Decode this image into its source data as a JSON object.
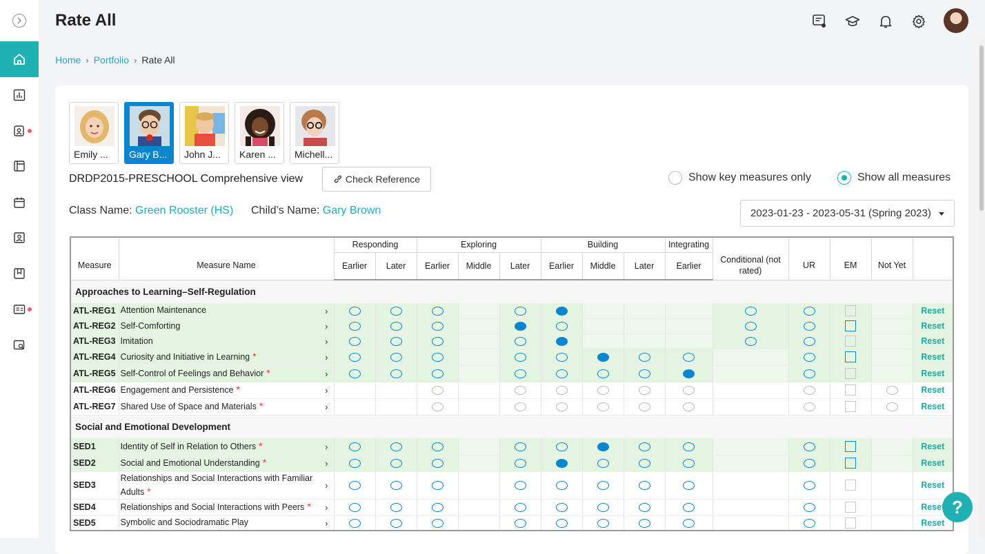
{
  "page": {
    "title": "Rate All"
  },
  "breadcrumb": [
    {
      "label": "Home"
    },
    {
      "label": "Portfolio"
    },
    {
      "label": "Rate All"
    }
  ],
  "children": [
    {
      "name": "Emily ...",
      "selected": false
    },
    {
      "name": "Gary B...",
      "selected": true
    },
    {
      "name": "John J...",
      "selected": false
    },
    {
      "name": "Karen ...",
      "selected": false
    },
    {
      "name": "Michell...",
      "selected": false
    }
  ],
  "view": {
    "title": "DRDP2015-PRESCHOOL Comprehensive view",
    "check_reference": "Check Reference",
    "radio_key": "Show key measures only",
    "radio_all": "Show all measures",
    "class_label": "Class Name:",
    "class_value": "Green Rooster (HS)",
    "child_label": "Child’s Name:",
    "child_value": "Gary Brown",
    "date_range": "2023-01-23 - 2023-05-31 (Spring 2023)"
  },
  "table": {
    "headers": {
      "measure": "Measure",
      "measure_name": "Measure Name",
      "groups": [
        "Responding",
        "Exploring",
        "Building",
        "Integrating"
      ],
      "levels": [
        "Earlier",
        "Later",
        "Earlier",
        "Middle",
        "Later",
        "Earlier",
        "Middle",
        "Later",
        "Earlier"
      ],
      "conditional": "Conditional (not rated)",
      "ur": "UR",
      "em": "EM",
      "not_yet": "Not Yet"
    },
    "reset_label": "Reset",
    "sections": [
      {
        "title": "Approaches to Learning–Self-Regulation",
        "rows": [
          {
            "code": "ATL-REG1",
            "name": "Attention Maintenance",
            "star": false,
            "tint": "g",
            "levels": [
              "o",
              "o",
              "o",
              "",
              "o",
              "f",
              "",
              "",
              ""
            ],
            "cond": "o",
            "ur": "o",
            "em": "gy",
            "notyet": ""
          },
          {
            "code": "ATL-REG2",
            "name": "Self-Comforting",
            "star": false,
            "tint": "g",
            "levels": [
              "o",
              "o",
              "o",
              "",
              "f",
              "o",
              "",
              "",
              ""
            ],
            "cond": "o",
            "ur": "o",
            "em": "b",
            "notyet": ""
          },
          {
            "code": "ATL-REG3",
            "name": "Imitation",
            "star": false,
            "tint": "g",
            "levels": [
              "o",
              "o",
              "o",
              "",
              "o",
              "f",
              "",
              "",
              ""
            ],
            "cond": "o",
            "ur": "o",
            "em": "gy",
            "notyet": ""
          },
          {
            "code": "ATL-REG4",
            "name": "Curiosity and Initiative in Learning",
            "star": true,
            "tint": "g",
            "levels": [
              "o",
              "o",
              "o",
              "",
              "o",
              "o",
              "f",
              "o",
              "o"
            ],
            "cond": "",
            "ur": "o",
            "em": "b",
            "notyet": ""
          },
          {
            "code": "ATL-REG5",
            "name": "Self-Control of Feelings and Behavior",
            "star": true,
            "tint": "g",
            "levels": [
              "o",
              "o",
              "o",
              "",
              "o",
              "o",
              "o",
              "o",
              "f"
            ],
            "cond": "",
            "ur": "o",
            "em": "gy",
            "notyet": ""
          },
          {
            "code": "ATL-REG6",
            "name": "Engagement and Persistence",
            "star": true,
            "tint": "w",
            "levels": [
              "",
              "",
              "gy",
              "",
              "gy",
              "gy",
              "gy",
              "gy",
              "gy"
            ],
            "cond": "",
            "ur": "gy",
            "em": "gy",
            "notyet": "gy"
          },
          {
            "code": "ATL-REG7",
            "name": "Shared Use of Space and Materials",
            "star": true,
            "tint": "w",
            "levels": [
              "",
              "",
              "gy",
              "",
              "gy",
              "gy",
              "gy",
              "gy",
              "gy"
            ],
            "cond": "",
            "ur": "gy",
            "em": "gy",
            "notyet": "gy"
          }
        ]
      },
      {
        "title": "Social and Emotional Development",
        "rows": [
          {
            "code": "SED1",
            "name": "Identity of Self in Relation to Others",
            "star": true,
            "tint": "g",
            "levels": [
              "o",
              "o",
              "o",
              "",
              "o",
              "o",
              "f",
              "o",
              "o"
            ],
            "cond": "",
            "ur": "o",
            "em": "b",
            "notyet": ""
          },
          {
            "code": "SED2",
            "name": "Social and Emotional Understanding",
            "star": true,
            "tint": "g",
            "levels": [
              "o",
              "o",
              "o",
              "",
              "o",
              "f",
              "o",
              "o",
              "o"
            ],
            "cond": "",
            "ur": "o",
            "em": "b",
            "notyet": ""
          },
          {
            "code": "SED3",
            "name": "Relationships and Social Interactions with Familiar Adults",
            "star": true,
            "tint": "w",
            "levels": [
              "o",
              "o",
              "o",
              "",
              "o",
              "o",
              "o",
              "o",
              "o"
            ],
            "cond": "",
            "ur": "o",
            "em": "gy",
            "notyet": ""
          },
          {
            "code": "SED4",
            "name": "Relationships and Social Interactions with Peers",
            "star": true,
            "tint": "w",
            "levels": [
              "o",
              "o",
              "o",
              "",
              "o",
              "o",
              "o",
              "o",
              "o"
            ],
            "cond": "",
            "ur": "o",
            "em": "gy",
            "notyet": ""
          },
          {
            "code": "SED5",
            "name": "Symbolic and Sociodramatic Play",
            "star": false,
            "tint": "w",
            "levels": [
              "o",
              "o",
              "o",
              "",
              "o",
              "o",
              "o",
              "o",
              "o"
            ],
            "cond": "",
            "ur": "o",
            "em": "gy",
            "notyet": ""
          }
        ]
      }
    ]
  },
  "help": {
    "label": "?"
  }
}
